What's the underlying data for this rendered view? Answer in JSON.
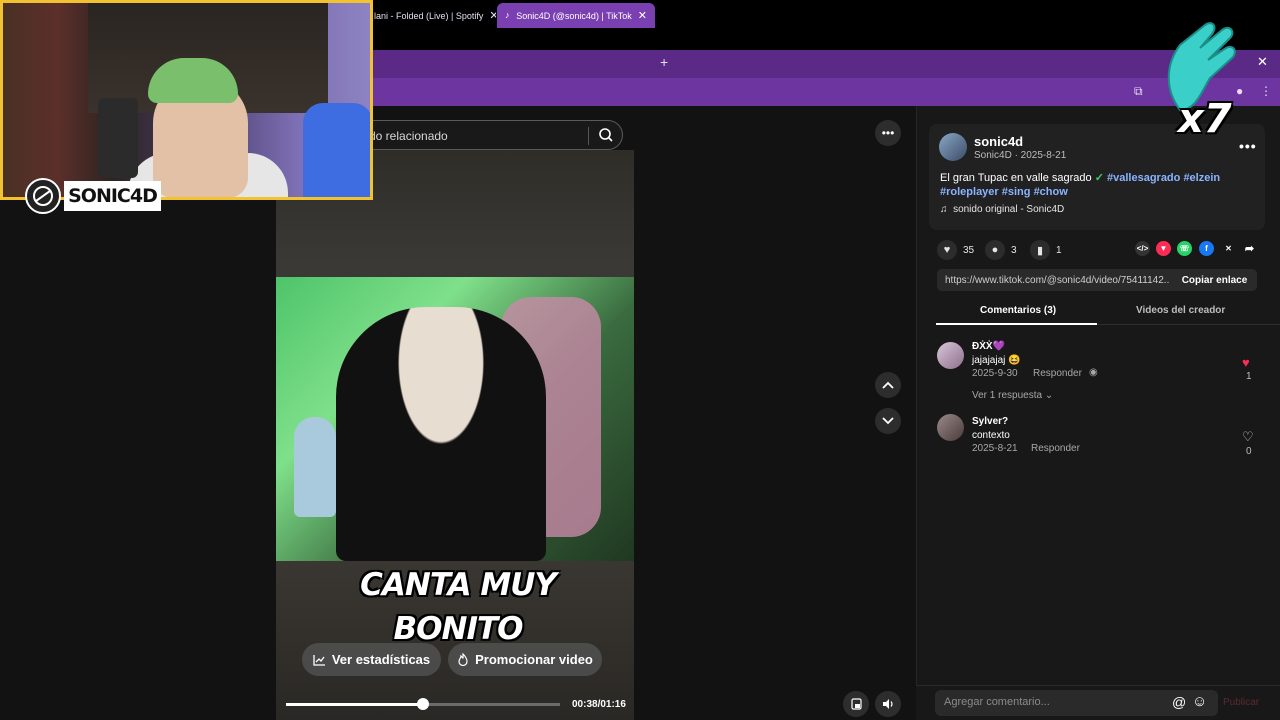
{
  "browser": {
    "tabs": [
      {
        "title": "lani - Folded (Live) | Spotify",
        "close": "✕"
      },
      {
        "title": "Sonic4D (@sonic4d) | TikTok",
        "close": "✕",
        "active": true
      }
    ],
    "new_tab": "+",
    "window_close": "✕"
  },
  "search": {
    "placeholder": "do relacionado"
  },
  "video": {
    "caption_line1": "CANTA MUY",
    "caption_line2": "BONITO",
    "btn_stats": "Ver estadísticas",
    "btn_promote": "Promocionar video",
    "time": "00:38/01:16",
    "progress": 0.5
  },
  "post": {
    "username": "sonic4d",
    "subline": "Sonic4D · 2025-8-21",
    "desc_text": "El gran Tupac en valle sagrado",
    "desc_check": "✓",
    "tag1": "#vallesagrado",
    "tag2": "#elzein",
    "tag3": "#roleplayer",
    "tag4": "#sing",
    "tag5": "#chow",
    "music": "sonido original - Sonic4D",
    "likes": "35",
    "comments": "3",
    "saves": "1",
    "link": "https://www.tiktok.com/@sonic4d/video/75411142...",
    "copy_label": "Copiar enlace"
  },
  "tabs": {
    "comments": "Comentarios (3)",
    "creator": "Videos del creador"
  },
  "comments": [
    {
      "name": "ĐẊẊ💜",
      "text": "jajajajaj 😆",
      "date": "2025-9-30",
      "reply": "Responder",
      "likes": "1",
      "more": "Ver 1 respuesta"
    },
    {
      "name": "Sylver?",
      "text": "contexto",
      "date": "2025-8-21",
      "reply": "Responder",
      "likes": "0"
    }
  ],
  "input": {
    "placeholder": "Agregar comentario...",
    "publish": "Publicar",
    "at": "@",
    "emoji": "☺"
  },
  "overlay": {
    "logo_text": "SONIC4D",
    "clap_count": "x7"
  },
  "colors": {
    "tiktok_accent": "#fe2c55",
    "chrome_purple": "#5b2a86",
    "webcam_border": "#f2c230"
  }
}
